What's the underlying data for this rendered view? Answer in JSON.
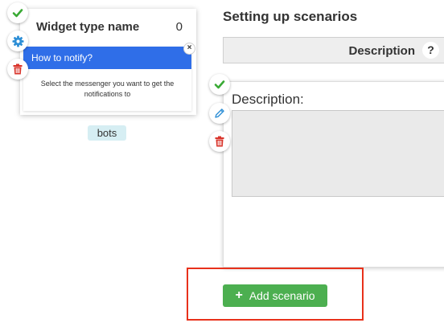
{
  "widget": {
    "title": "Widget type name",
    "count": "0",
    "notify": {
      "header": "How to notify?",
      "text": "Select the messenger you want to get the notifications to",
      "close_glyph": "×"
    },
    "tag": "bots",
    "actions": [
      {
        "icon": "check-icon",
        "color": "#3aaa35"
      },
      {
        "icon": "gear-icon",
        "color": "#2e8fd6"
      },
      {
        "icon": "trash-icon",
        "color": "#d9342b"
      }
    ]
  },
  "scenarios": {
    "title": "Setting up scenarios",
    "header_label": "Description",
    "help_glyph": "?",
    "description_label": "Description:",
    "description_value": "",
    "actions": [
      {
        "icon": "check-icon",
        "color": "#3aaa35"
      },
      {
        "icon": "pencil-icon",
        "color": "#2e8fd6"
      },
      {
        "icon": "trash-icon",
        "color": "#d9342b"
      }
    ],
    "add_button": {
      "plus_glyph": "+",
      "label": "Add scenario",
      "color": "#4caf50"
    }
  },
  "highlight_color": "#e8311b",
  "accent_blue": "#2f6ee8"
}
